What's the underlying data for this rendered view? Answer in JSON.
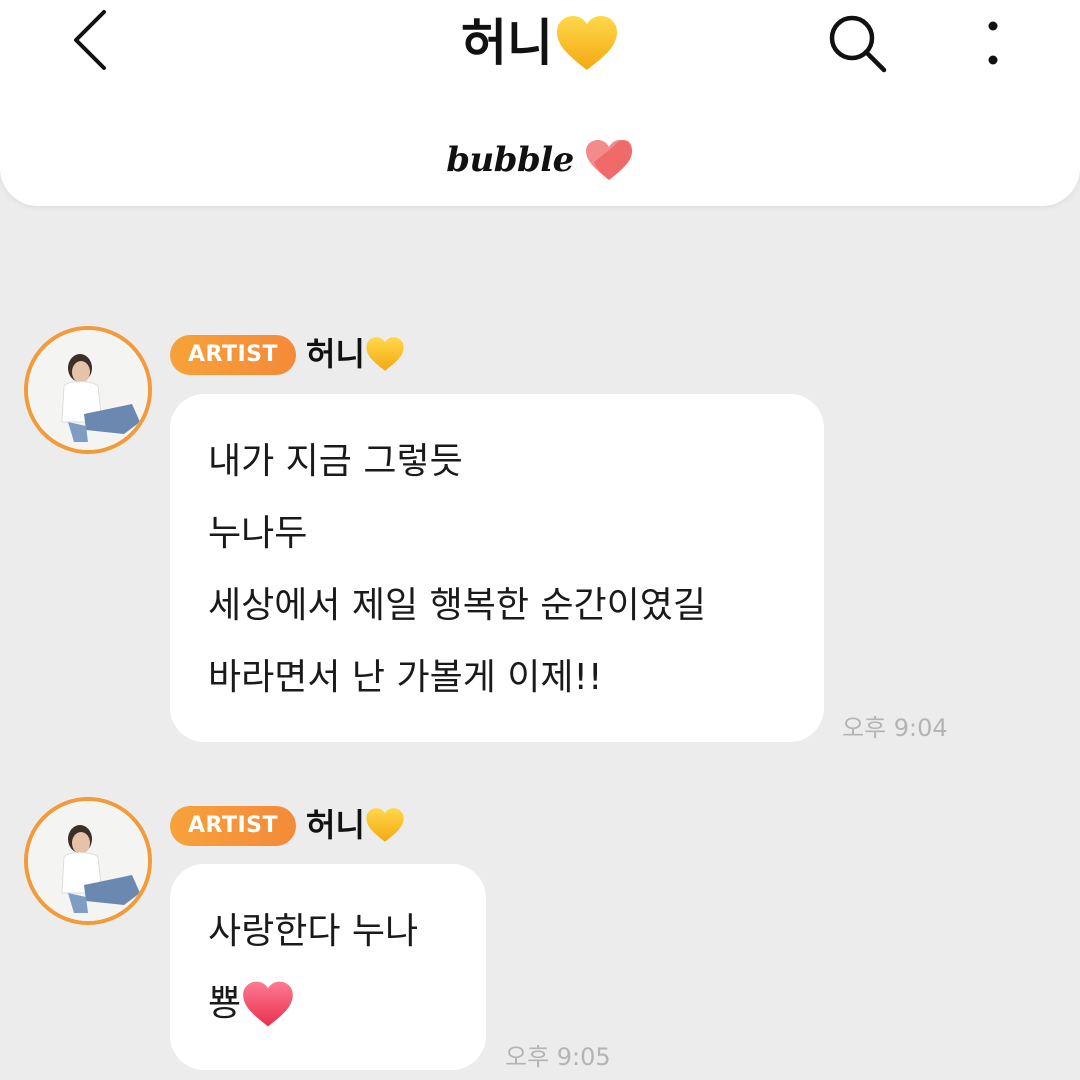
{
  "header": {
    "title": "허니",
    "title_emoji": "yellow-heart-icon",
    "brand": "bubble",
    "brand_icon": "bubble-heart-icon"
  },
  "colors": {
    "accent_orange": "#f48a3a",
    "background": "#ececec",
    "bubble_bg": "#ffffff",
    "yellow_heart": "#f8c21a",
    "pink_heart": "#f2576e"
  },
  "messages": [
    {
      "badge": "ARTIST",
      "sender": "허니",
      "sender_emoji": "yellow-heart-icon",
      "lines": [
        "내가 지금 그렇듯",
        "누나두",
        "세상에서 제일 행복한 순간이였길",
        "바라면서 난 가볼게 이제!!"
      ],
      "time": "오후 9:04"
    },
    {
      "badge": "ARTIST",
      "sender": "허니",
      "sender_emoji": "yellow-heart-icon",
      "lines": [
        "사랑한다 누나",
        "뿅"
      ],
      "line_emoji": "pink-heart-icon",
      "time": "오후 9:05"
    }
  ]
}
